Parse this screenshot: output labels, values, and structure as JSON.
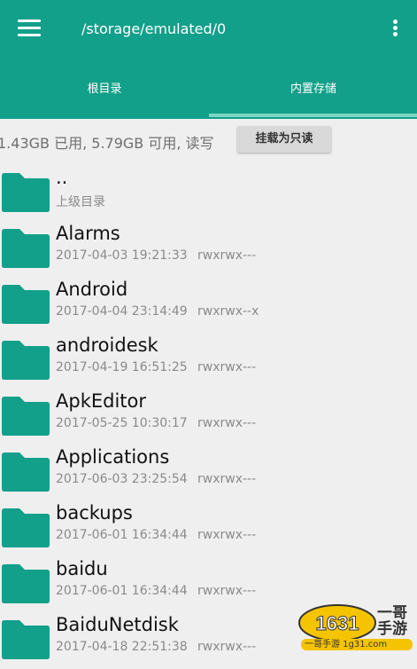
{
  "appbar": {
    "path": "/storage/emulated/0",
    "tabs": [
      {
        "label": "根目录"
      },
      {
        "label": "内置存储"
      }
    ],
    "selected_tab": "内置存储",
    "color": "#12a08a",
    "indicator_color": "#7dd6c5"
  },
  "storage": {
    "info": "1.43GB 已用, 5.79GB 可用, 读写",
    "mount_button": "挂载为只读"
  },
  "files": [
    {
      "name": "..",
      "date": "上级目录",
      "perm": ""
    },
    {
      "name": "Alarms",
      "date": "2017-04-03 19:21:33",
      "perm": "rwxrwx---"
    },
    {
      "name": "Android",
      "date": "2017-04-04 23:14:49",
      "perm": "rwxrwx--x"
    },
    {
      "name": "androidesk",
      "date": "2017-04-19 16:51:25",
      "perm": "rwxrwx---"
    },
    {
      "name": "ApkEditor",
      "date": "2017-05-25 10:30:17",
      "perm": "rwxrwx---"
    },
    {
      "name": "Applications",
      "date": "2017-06-03 23:25:54",
      "perm": "rwxrwx---"
    },
    {
      "name": "backups",
      "date": "2017-06-01 16:34:44",
      "perm": "rwxrwx---"
    },
    {
      "name": "baidu",
      "date": "2017-06-01 16:34:44",
      "perm": "rwxrwx---"
    },
    {
      "name": "BaiduNetdisk",
      "date": "2017-04-18 22:51:38",
      "perm": "rwxrwx---"
    }
  ],
  "icons": {
    "menu": "hamburger-menu-icon",
    "more": "vertical-ellipsis-icon",
    "folder": "folder-icon"
  },
  "watermark": {
    "badge": "1631",
    "title": "一哥手游",
    "url": "一哥手游 1g31.com"
  }
}
